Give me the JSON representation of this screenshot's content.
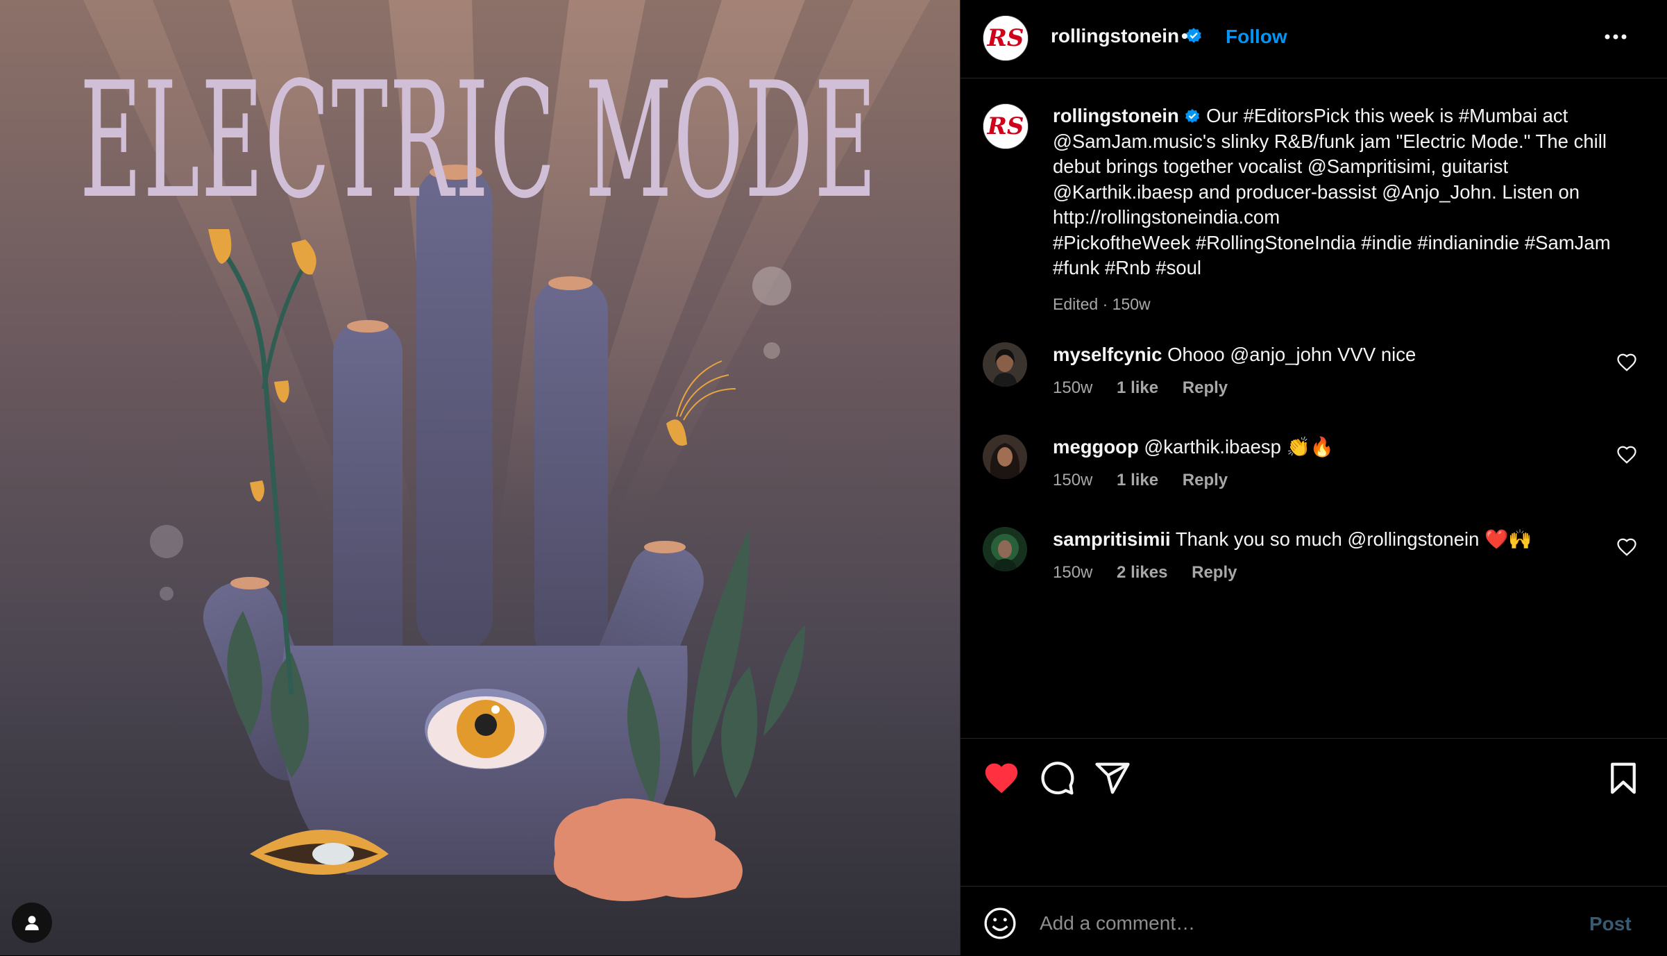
{
  "artwork": {
    "title": "ELECTRIC MODE"
  },
  "header": {
    "username": "rollingstonein",
    "separator": "•",
    "follow_label": "Follow",
    "more_icon": "more-horizontal-icon"
  },
  "caption": {
    "username": "rollingstonein",
    "text": "Our #EditorsPick this week is #Mumbai act @SamJam.music's slinky R&B/funk jam \"Electric Mode.\" The chill debut brings together vocalist @Sampritisimi, guitarist @Karthik.ibaesp and producer-bassist @Anjo_John. Listen on http://rollingstoneindia.com",
    "hashtags": "#PickoftheWeek #RollingStoneIndia #indie #indianindie #SamJam #funk #Rnb #soul",
    "meta": "Edited · 150w"
  },
  "comments": [
    {
      "username": "myselfcynic",
      "text": "Ohooo @anjo_john VVV nice",
      "age": "150w",
      "likes": "1 like",
      "reply": "Reply"
    },
    {
      "username": "meggoop",
      "text": "@karthik.ibaesp 👏🔥",
      "age": "150w",
      "likes": "1 like",
      "reply": "Reply"
    },
    {
      "username": "sampritisimii",
      "text": "Thank you so much @rollingstonein ❤️🙌",
      "age": "150w",
      "likes": "2 likes",
      "reply": "Reply"
    }
  ],
  "actions": {
    "liked": true,
    "icons": [
      "heart-filled-icon",
      "comment-icon",
      "share-icon",
      "bookmark-icon"
    ]
  },
  "comment_box": {
    "placeholder": "Add a comment…",
    "post_label": "Post"
  },
  "colors": {
    "background": "#000000",
    "accent_blue": "#0095f6",
    "like_red": "#ff3040",
    "muted_text": "#a8a8a8",
    "divider": "#262626"
  }
}
